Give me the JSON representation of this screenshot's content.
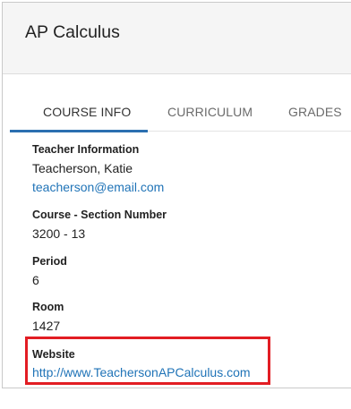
{
  "header": {
    "title": "AP Calculus"
  },
  "tabs": [
    {
      "label": "COURSE INFO",
      "active": true
    },
    {
      "label": "CURRICULUM",
      "active": false
    },
    {
      "label": "GRADES",
      "active": false
    }
  ],
  "teacher": {
    "label": "Teacher Information",
    "name": "Teacherson, Katie",
    "email": "teacherson@email.com"
  },
  "section": {
    "label": "Course - Section Number",
    "value": "3200 - 13"
  },
  "period": {
    "label": "Period",
    "value": "6"
  },
  "room": {
    "label": "Room",
    "value": "1427"
  },
  "website": {
    "label": "Website",
    "value": "http://www.TeachersonAPCalculus.com"
  },
  "colors": {
    "accent": "#2b6fb0",
    "link": "#1f73b7",
    "highlight": "#e21d23",
    "header_bg": "#f5f5f5"
  }
}
